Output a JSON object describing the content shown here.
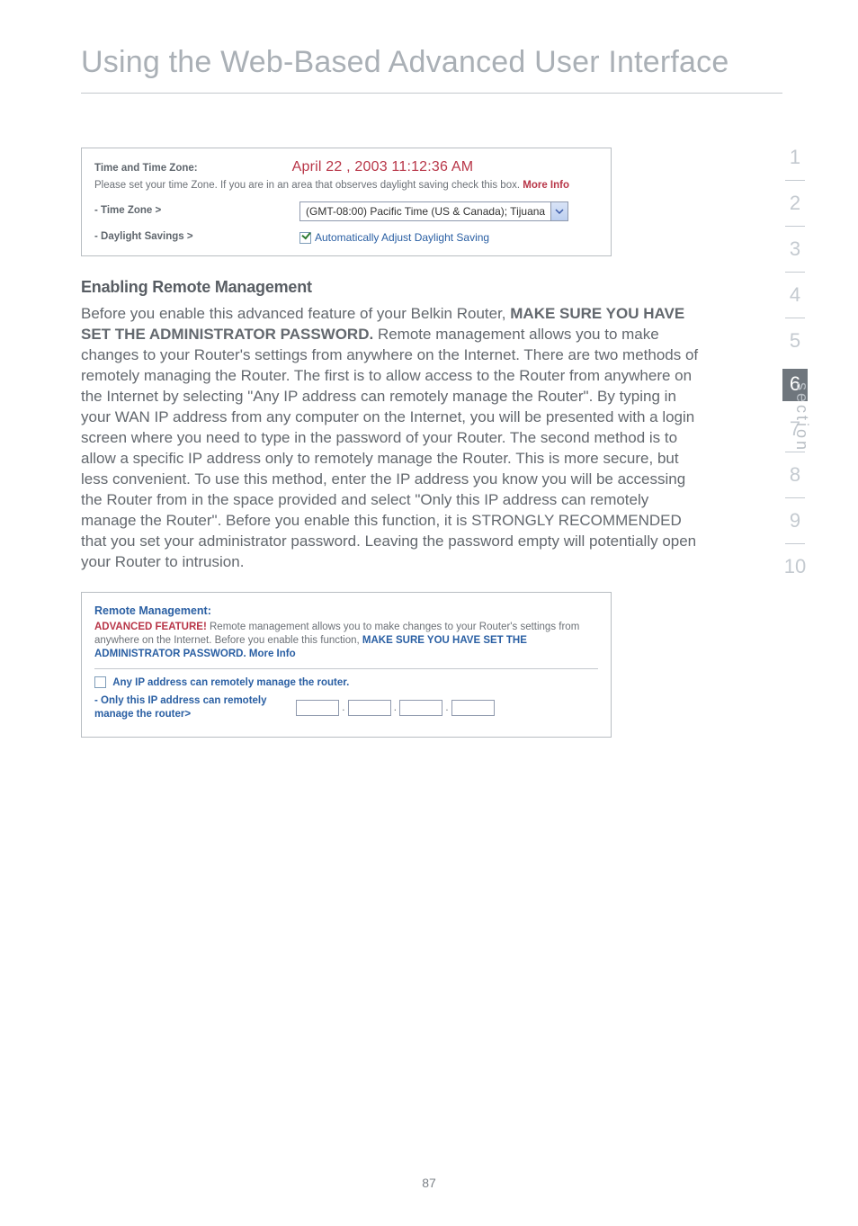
{
  "page": {
    "title": "Using the Web-Based Advanced User Interface",
    "number": "87"
  },
  "rail": {
    "items": [
      "1",
      "2",
      "3",
      "4",
      "5",
      "6",
      "7",
      "8",
      "9",
      "10"
    ],
    "active_index": 5,
    "label": "section"
  },
  "time_box": {
    "heading": "Time and Time Zone:",
    "datetime": "April 22 , 2003   11:12:36 AM",
    "sub_pre": "Please set your time Zone. If you are in an area that observes daylight saving check this box. ",
    "sub_more": "More Info",
    "tz_label": "- Time Zone >",
    "tz_value": "(GMT-08:00) Pacific Time (US & Canada); Tijuana",
    "dst_label": "- Daylight Savings >",
    "dst_checkbox_checked": true,
    "dst_text": "Automatically Adjust Daylight Saving"
  },
  "section_heading": "Enabling Remote Management",
  "body": {
    "pre": "Before you enable this advanced feature of your Belkin Router, ",
    "bold": "MAKE SURE YOU HAVE SET THE ADMINISTRATOR PASSWORD.",
    "post": " Remote management allows you to make changes to your Router's settings from anywhere on the Internet. There are two methods of remotely managing the Router. The first is to allow access to the Router from anywhere on the Internet by selecting \"Any IP address can remotely manage the Router\". By typing in your WAN IP address from any computer on the Internet, you will be presented with a login screen where you need to type in the password of your Router. The second method is to allow a specific IP address only to remotely manage the Router. This is more secure, but less convenient. To use this method, enter the IP address you know you will be accessing the Router from in the space provided and select \"Only this IP address can remotely manage the Router\". Before you enable this function, it is STRONGLY RECOMMENDED that you set your administrator password. Leaving the password empty will potentially open your Router to intrusion."
  },
  "remote_box": {
    "title": "Remote Management:",
    "adv": "ADVANCED FEATURE!",
    "desc_pre": " Remote management allows you to make changes to your Router's settings from anywhere on the Internet. Before you enable this function, ",
    "desc_bold": "MAKE SURE YOU HAVE SET THE ADMINISTRATOR PASSWORD.",
    "more": " More Info",
    "any_ip_checked": false,
    "any_ip_label": "Any IP address can remotely manage the router.",
    "only_label": "- Only this IP address can remotely manage the router>"
  }
}
